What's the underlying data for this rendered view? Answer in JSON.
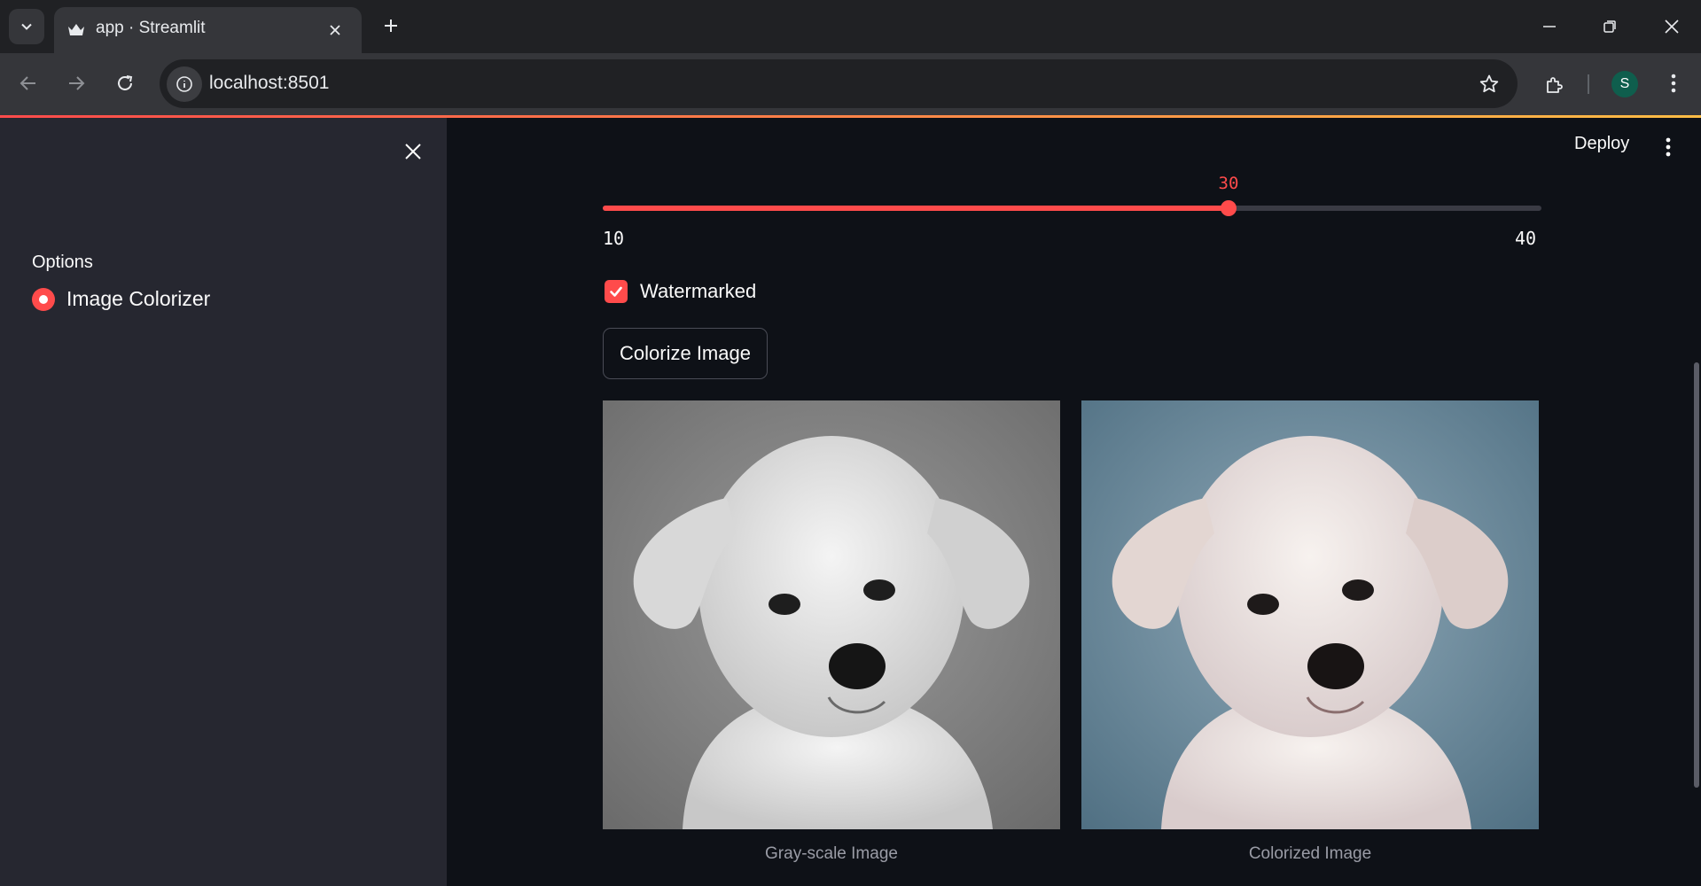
{
  "browser": {
    "tab_title": "app · Streamlit",
    "url": "localhost:8501",
    "profile_initial": "S",
    "icons": [
      "tab-search-icon",
      "streamlit-favicon-icon",
      "close-icon",
      "plus-icon",
      "minimize-icon",
      "restore-icon",
      "close-window-icon",
      "back-arrow-icon",
      "forward-arrow-icon",
      "reload-icon",
      "site-info-icon",
      "star-icon",
      "extensions-icon",
      "kebab-menu-icon"
    ]
  },
  "sidebar": {
    "label": "Options",
    "radio_options": [
      {
        "label": "Image Colorizer",
        "selected": true
      }
    ]
  },
  "main": {
    "deploy_label": "Deploy",
    "slider": {
      "min": 10,
      "max": 40,
      "value": 30,
      "min_label": "10",
      "max_label": "40",
      "value_label": "30"
    },
    "checkbox": {
      "label": "Watermarked",
      "checked": true
    },
    "button_label": "Colorize Image",
    "images": [
      {
        "caption": "Gray-scale Image",
        "style": "grayscale"
      },
      {
        "caption": "Colorized Image",
        "style": "color"
      }
    ]
  },
  "colors": {
    "accent": "#ff4b4b",
    "sidebar_bg": "#262730",
    "main_bg": "#0e1117"
  }
}
